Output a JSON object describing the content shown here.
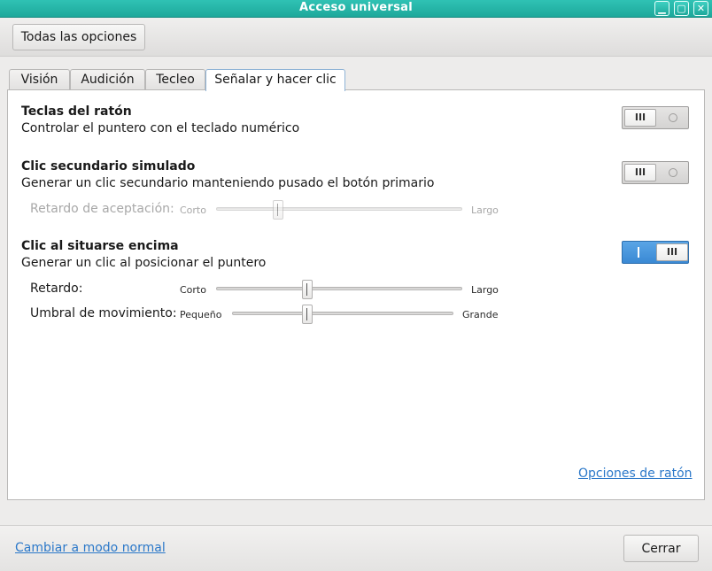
{
  "window": {
    "title": "Acceso universal",
    "controls": {
      "minimize": "▁",
      "maximize": "▢",
      "close": "✕"
    }
  },
  "toolbar": {
    "all_settings": "Todas las opciones"
  },
  "tabs": [
    {
      "label": "Visión",
      "active": false
    },
    {
      "label": "Audición",
      "active": false
    },
    {
      "label": "Tecleo",
      "active": false
    },
    {
      "label": "Señalar y hacer clic",
      "active": true
    }
  ],
  "mouse_keys": {
    "title": "Teclas del ratón",
    "description": "Controlar el puntero con el teclado numérico",
    "switch": {
      "on": false,
      "on_glyph": "III"
    }
  },
  "secondary_click": {
    "title": "Clic secundario simulado",
    "description": "Generar un clic secundario manteniendo pusado el botón primario",
    "switch": {
      "on": false,
      "on_glyph": "III"
    },
    "acceptance_delay": {
      "label": "Retardo de aceptación:",
      "min_label": "Corto",
      "max_label": "Largo",
      "value": 0.25,
      "enabled": false
    }
  },
  "hover_click": {
    "title": "Clic al situarse encima",
    "description": "Generar un clic al posicionar el puntero",
    "switch": {
      "on": true,
      "on_glyph": "III"
    },
    "delay": {
      "label": "Retardo:",
      "min_label": "Corto",
      "max_label": "Largo",
      "value": 0.37,
      "enabled": true
    },
    "motion_threshold": {
      "label": "Umbral de movimiento:",
      "min_label": "Pequeño",
      "max_label": "Grande",
      "value": 0.34,
      "enabled": true
    }
  },
  "links": {
    "mouse_options": "Opciones de ratón",
    "normal_mode": "Cambiar a modo normal"
  },
  "footer": {
    "close": "Cerrar"
  },
  "colors": {
    "titlebar": "#1ea89b",
    "accent": "#3a89d4",
    "link": "#2b78c9"
  }
}
